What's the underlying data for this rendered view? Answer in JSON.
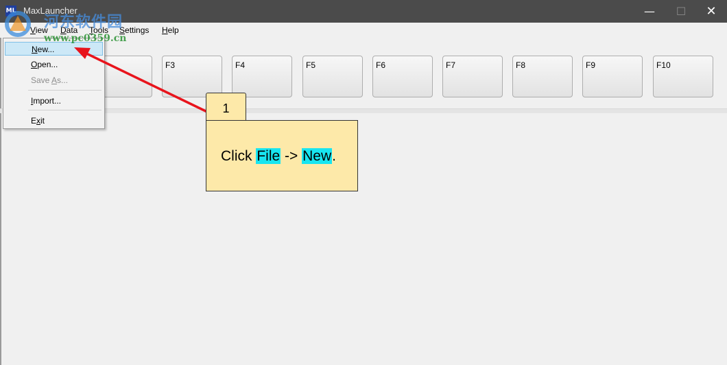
{
  "window": {
    "app_icon_text": "ML",
    "title": "MaxLauncher",
    "minimize_glyph": "—",
    "maximize_glyph": "☐",
    "close_glyph": "✕"
  },
  "menubar": {
    "view_underlined": "V",
    "view_rest": "iew",
    "data_underlined": "D",
    "data_rest": "ata",
    "tools_underlined": "T",
    "tools_rest": "ools",
    "settings_underlined": "S",
    "settings_rest": "ettings",
    "help_underlined": "H",
    "help_rest": "elp"
  },
  "file_menu": {
    "new_u": "N",
    "new_rest": "ew...",
    "open_u": "O",
    "open_rest": "pen...",
    "saveas_pre": "Save ",
    "saveas_u": "A",
    "saveas_rest": "s...",
    "import_u": "I",
    "import_rest": "mport...",
    "exit_pre": "E",
    "exit_u": "x",
    "exit_rest": "it"
  },
  "function_keys": [
    "F3",
    "F4",
    "F5",
    "F6",
    "F7",
    "F8",
    "F9",
    "F10"
  ],
  "watermark": {
    "chinese": "河东软件园",
    "url": "www.pc0359.cn"
  },
  "callout": {
    "step": "1",
    "text_prefix": "Click ",
    "highlight_file": "File",
    "text_mid": " -> ",
    "highlight_new": "New",
    "text_suffix": "."
  },
  "colors": {
    "titlebar": "#4b4b4b",
    "callout_fill": "#fde9a9",
    "highlight": "#18e5f0",
    "arrow": "#e8141c"
  }
}
